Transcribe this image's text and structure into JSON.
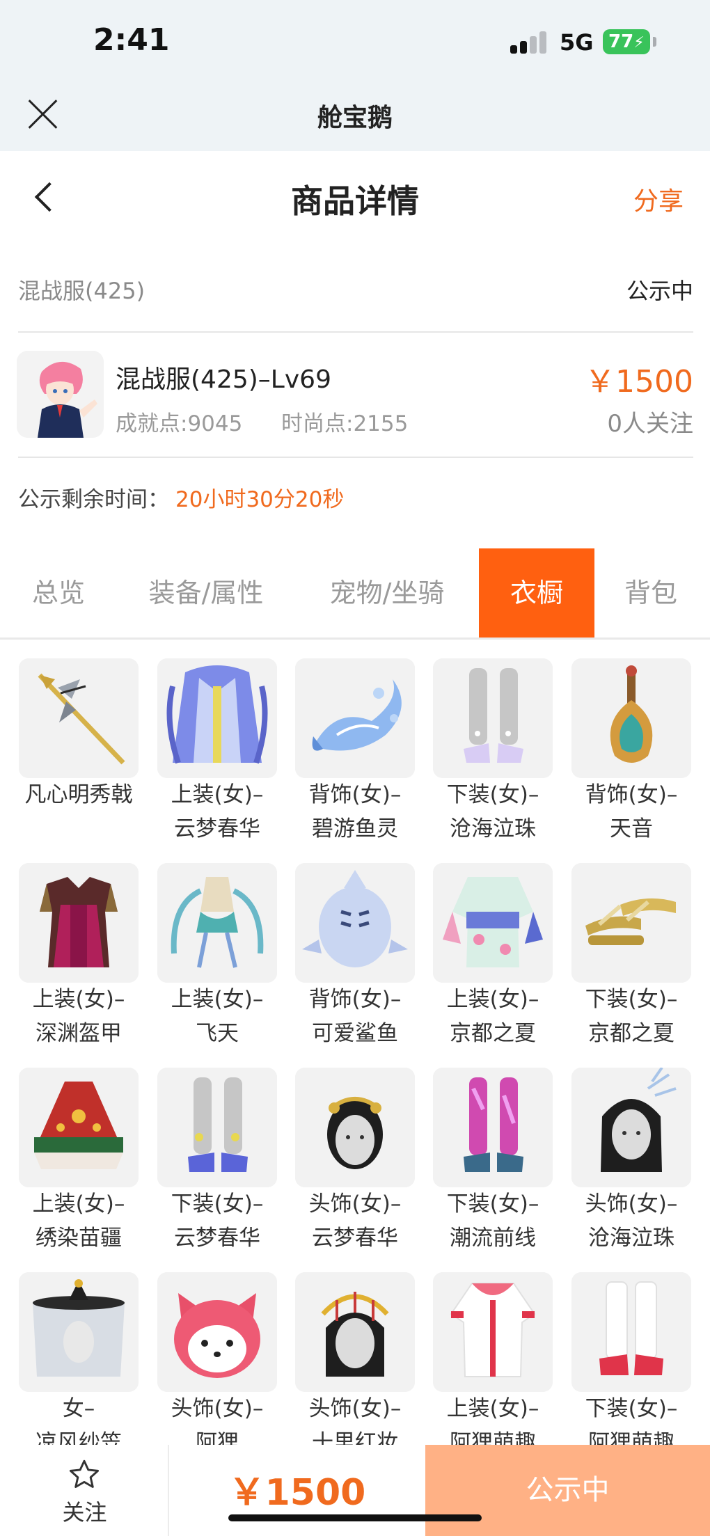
{
  "status_bar": {
    "time": "2:41",
    "network": "5G",
    "battery": "77"
  },
  "app_bar": {
    "title": "舱宝鹅"
  },
  "header": {
    "title": "商品详情",
    "share": "分享"
  },
  "listing": {
    "server": "混战服(425)",
    "status": "公示中",
    "product_title": "混战服(425)–Lv69",
    "achievement_points": "成就点:9045",
    "fashion_points": "时尚点:2155",
    "price": "￥1500",
    "followers": "0人关注"
  },
  "countdown": {
    "label": "公示剩余时间：",
    "value": "20小时30分20秒"
  },
  "tabs": [
    {
      "label": "总览",
      "active": false
    },
    {
      "label": "装备/属性",
      "active": false
    },
    {
      "label": "宠物/坐骑",
      "active": false
    },
    {
      "label": "衣橱",
      "active": true
    },
    {
      "label": "背包",
      "active": false
    }
  ],
  "wardrobe": [
    {
      "name": "凡心明秀戟",
      "icon": "halberd-icon"
    },
    {
      "name": "上装(女)–云梦春华",
      "icon": "robe-icon"
    },
    {
      "name": "背饰(女)–碧游鱼灵",
      "icon": "water-fish-icon"
    },
    {
      "name": "下装(女)–沧海泣珠",
      "icon": "legs-icon"
    },
    {
      "name": "背饰(女)–天音",
      "icon": "pipa-icon"
    },
    {
      "name": "上装(女)–深渊盔甲",
      "icon": "armor-icon"
    },
    {
      "name": "上装(女)–飞天",
      "icon": "flying-dress-icon"
    },
    {
      "name": "背饰(女)–可爱鲨鱼",
      "icon": "shark-icon"
    },
    {
      "name": "上装(女)–京都之夏",
      "icon": "kimono-icon"
    },
    {
      "name": "下装(女)–京都之夏",
      "icon": "sandals-icon"
    },
    {
      "name": "上装(女)–绣染苗疆",
      "icon": "poncho-icon"
    },
    {
      "name": "下装(女)–云梦春华",
      "icon": "legs-icon"
    },
    {
      "name": "头饰(女)–云梦春华",
      "icon": "head-ornament-icon"
    },
    {
      "name": "下装(女)–潮流前线",
      "icon": "legs-icon"
    },
    {
      "name": "头饰(女)–沧海泣珠",
      "icon": "head-ornament-icon"
    },
    {
      "name": "女–凉风纱笠",
      "icon": "veil-hat-icon"
    },
    {
      "name": "头饰(女)–阿狸",
      "icon": "fox-head-icon"
    },
    {
      "name": "头饰(女)–十里红妆",
      "icon": "head-ornament-icon"
    },
    {
      "name": "上装(女)–阿狸萌趣",
      "icon": "hoodie-icon"
    },
    {
      "name": "下装(女)–阿狸萌趣",
      "icon": "boots-icon"
    }
  ],
  "bottom_bar": {
    "follow_label": "关注",
    "price": "￥1500",
    "status_button": "公示中"
  },
  "colors": {
    "accent": "#f06a1e",
    "active_tab": "#ff6010",
    "status_button": "#ffb185"
  }
}
